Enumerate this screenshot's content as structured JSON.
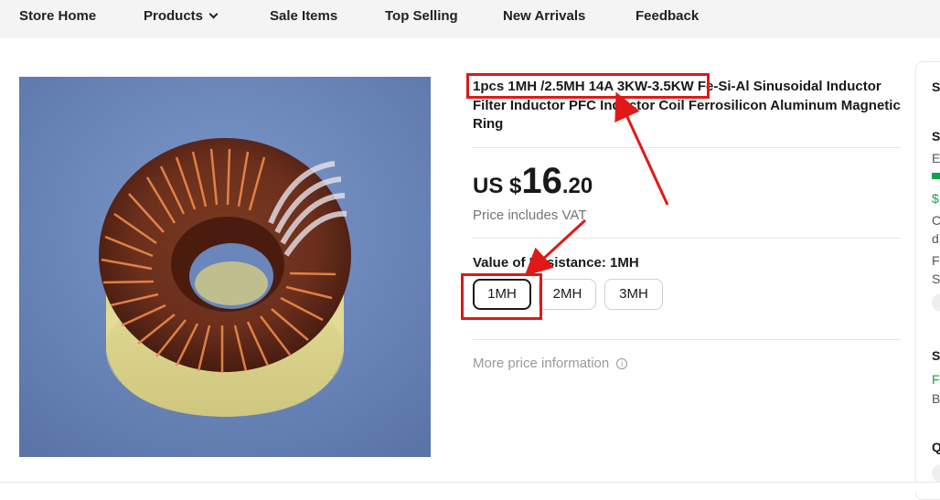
{
  "nav": {
    "store_home": "Store Home",
    "products": "Products",
    "sale_items": "Sale Items",
    "top_selling": "Top Selling",
    "new_arrivals": "New Arrivals",
    "feedback": "Feedback"
  },
  "product": {
    "title": "1pcs 1MH /2.5MH 14A 3KW-3.5KW Fe-Si-Al Sinusoidal Inductor Filter Inductor PFC Inductor Coil Ferrosilicon Aluminum Magnetic Ring",
    "image_alt": "toroidal inductor coil"
  },
  "price": {
    "currency": "US $",
    "integer": "16",
    "decimal": ".20",
    "vat_note": "Price includes VAT"
  },
  "variant": {
    "label": "Value of Resistance: 1MH",
    "options": [
      "1MH",
      "2MH",
      "3MH"
    ],
    "selected": "1MH"
  },
  "more_price_info": "More price information",
  "side_panel": {
    "lines": [
      "Sh",
      "Sh",
      "Es",
      "$",
      "C",
      "d",
      "Fr",
      "St",
      "Se",
      "Fr",
      "B",
      "Q"
    ]
  },
  "colors": {
    "annotation_red": "#e01818",
    "nav_bg": "#f4f4f4",
    "shipping_green": "#1a9e4c"
  }
}
